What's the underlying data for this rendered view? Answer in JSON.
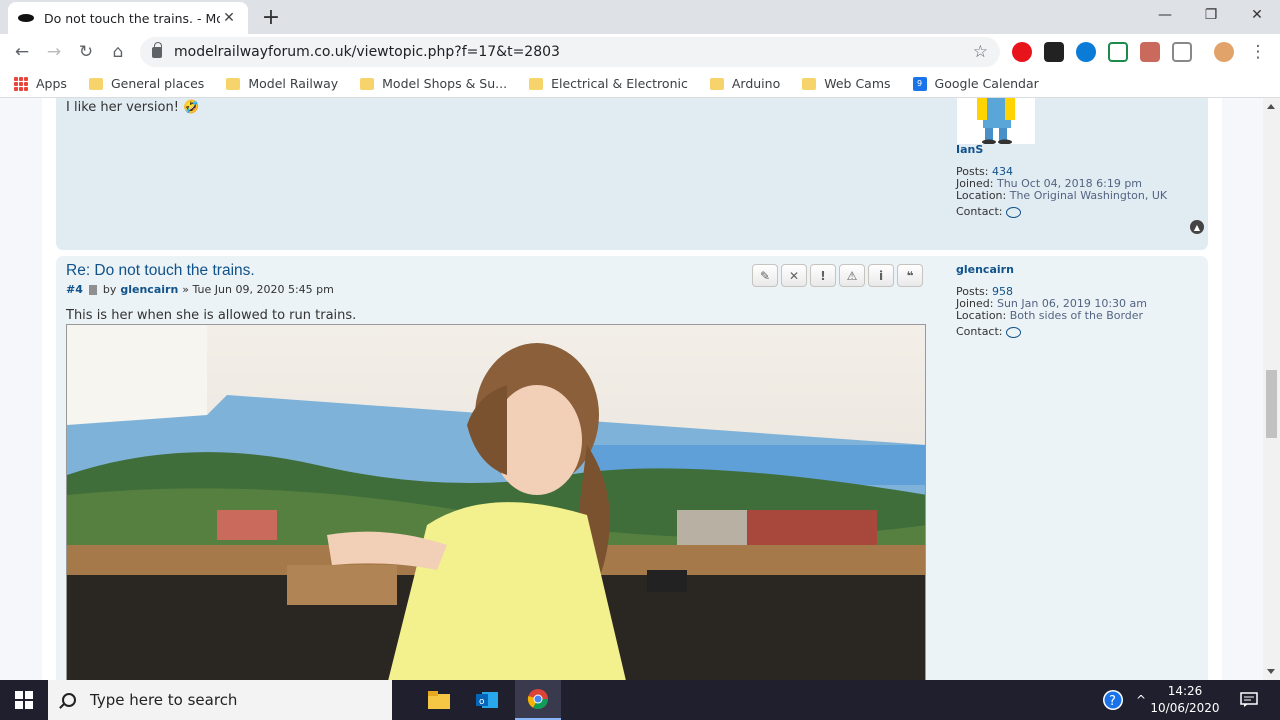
{
  "browser": {
    "tab_title": "Do not touch the trains. - Model Railway Forum",
    "url": "modelrailwayforum.co.uk/viewtopic.php?f=17&t=2803"
  },
  "bookmarks": [
    {
      "label": "Apps",
      "icon": "apps-grid-icon"
    },
    {
      "label": "General places",
      "icon": "folder-icon"
    },
    {
      "label": "Model Railway",
      "icon": "folder-icon"
    },
    {
      "label": "Model Shops & Su...",
      "icon": "folder-icon"
    },
    {
      "label": "Electrical & Electronic",
      "icon": "folder-icon"
    },
    {
      "label": "Arduino",
      "icon": "folder-icon"
    },
    {
      "label": "Web Cams",
      "icon": "folder-icon"
    },
    {
      "label": "Google Calendar",
      "icon": "calendar-icon",
      "badge": "9"
    }
  ],
  "post1": {
    "text": "I like her version! 🤣",
    "author": "IanS",
    "posts_label": "Posts:",
    "posts_value": "434",
    "joined_label": "Joined:",
    "joined_value": "Thu Oct 04, 2018 6:19 pm",
    "location_label": "Location:",
    "location_value": "The Original Washington, UK",
    "contact_label": "Contact:"
  },
  "post2": {
    "title": "Re: Do not touch the trains.",
    "number": "#4",
    "by": "by",
    "author": "glencairn",
    "date": "» Tue Jun 09, 2020 5:45 pm",
    "text": "This is her when she is allowed to run trains.",
    "posts_label": "Posts:",
    "posts_value": "958",
    "joined_label": "Joined:",
    "joined_value": "Sun Jan 06, 2019 10:30 am",
    "location_label": "Location:",
    "location_value": "Both sides of the Border",
    "contact_label": "Contact:",
    "buttons": [
      "edit-icon",
      "delete-icon",
      "warn-icon",
      "report-icon",
      "info-icon",
      "quote-icon"
    ]
  },
  "taskbar": {
    "search_placeholder": "Type here to search",
    "time": "14:26",
    "date": "10/06/2020"
  },
  "colors": {
    "link": "#105289",
    "post_bg_1": "#e1ebf2",
    "post_bg_2": "#ecf3f7",
    "taskbar": "#1f1f2e"
  }
}
